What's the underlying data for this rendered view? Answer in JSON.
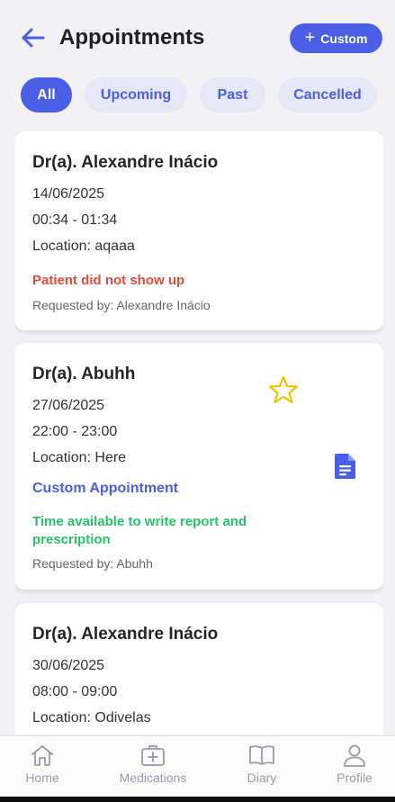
{
  "header": {
    "title": "Appointments",
    "custom_button": "Custom"
  },
  "filters": [
    {
      "label": "All",
      "active": true
    },
    {
      "label": "Upcoming",
      "active": false
    },
    {
      "label": "Past",
      "active": false
    },
    {
      "label": "Cancelled",
      "active": false
    }
  ],
  "appointments": [
    {
      "doctor": "Dr(a). Alexandre Inácio",
      "date": "14/06/2025",
      "time": "00:34 - 01:34",
      "location": "Location: aqaaa",
      "status": "Patient did not show up",
      "requested_by": "Requested by: Alexandre Inácio"
    },
    {
      "doctor": "Dr(a). Abuhh",
      "date": "27/06/2025",
      "time": "22:00 - 23:00",
      "location": "Location: Here",
      "type": "Custom Appointment",
      "status": "Time available to write report and prescription",
      "requested_by": "Requested by: Abuhh"
    },
    {
      "doctor": "Dr(a). Alexandre Inácio",
      "date": "30/06/2025",
      "time": "08:00 - 09:00",
      "location": "Location: Odivelas"
    }
  ],
  "tabbar": [
    {
      "label": "Home",
      "icon": "home-icon"
    },
    {
      "label": "Medications",
      "icon": "medical-kit-icon"
    },
    {
      "label": "Diary",
      "icon": "book-icon"
    },
    {
      "label": "Profile",
      "icon": "person-icon"
    }
  ],
  "colors": {
    "accent": "#4a5ee6",
    "status_red": "#e14b3c",
    "status_green": "#27c26a",
    "star": "#f2c400"
  }
}
